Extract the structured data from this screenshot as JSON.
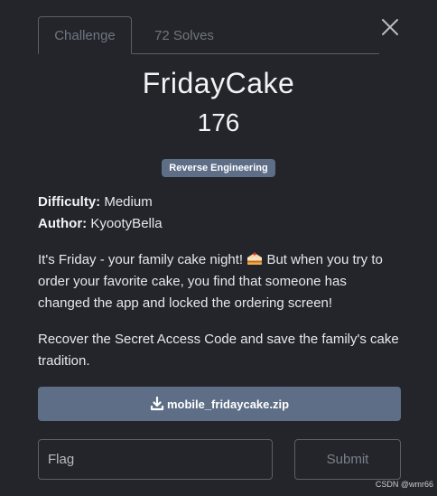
{
  "tabs": [
    {
      "label": "Challenge",
      "active": true
    },
    {
      "label": "72 Solves",
      "active": false
    }
  ],
  "challenge": {
    "name": "FridayCake",
    "points": "176",
    "category": "Reverse Engineering",
    "difficulty_label": "Difficulty:",
    "difficulty": "Medium",
    "author_label": "Author:",
    "author": "KyootyBella",
    "description_p1_a": "It's Friday - your family cake night!",
    "description_p1_b": "But when you try to order your favorite cake, you find that someone has changed the app and locked the ordering screen!",
    "description_p2": "Recover the Secret Access Code and save the family's cake tradition."
  },
  "download": {
    "filename": "mobile_fridaycake.zip",
    "icon": "download-icon"
  },
  "flag_input": {
    "placeholder": "Flag",
    "value": ""
  },
  "submit_label": "Submit",
  "watermark": "CSDN @wmr66",
  "colors": {
    "background": "#23252b",
    "accent": "#5d6e86",
    "border": "#5b5f66"
  }
}
